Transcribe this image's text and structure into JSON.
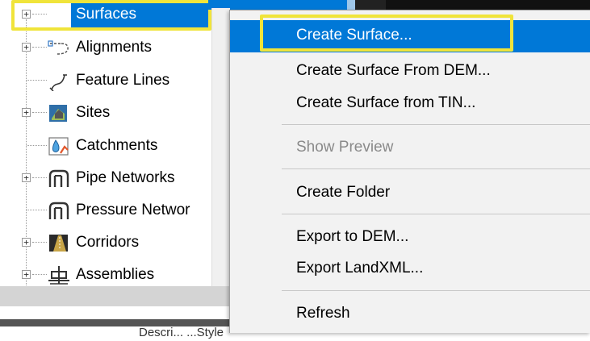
{
  "tree": {
    "items": [
      {
        "label": "Surfaces",
        "icon": "surface-icon",
        "expandable": true,
        "selected": true
      },
      {
        "label": "Alignments",
        "icon": "alignment-icon",
        "expandable": true,
        "selected": false
      },
      {
        "label": "Feature Lines",
        "icon": "feature-line-icon",
        "expandable": false,
        "selected": false
      },
      {
        "label": "Sites",
        "icon": "site-icon",
        "expandable": true,
        "selected": false
      },
      {
        "label": "Catchments",
        "icon": "catchment-icon",
        "expandable": false,
        "selected": false
      },
      {
        "label": "Pipe Networks",
        "icon": "pipe-network-icon",
        "expandable": true,
        "selected": false
      },
      {
        "label": "Pressure Networ",
        "icon": "pressure-network-icon",
        "expandable": false,
        "selected": false
      },
      {
        "label": "Corridors",
        "icon": "corridor-icon",
        "expandable": true,
        "selected": false
      },
      {
        "label": "Assemblies",
        "icon": "assembly-icon",
        "expandable": true,
        "selected": false
      }
    ],
    "expander_symbol": "+"
  },
  "context_menu": {
    "items": [
      {
        "label": "Create Surface...",
        "state": "active"
      },
      {
        "label": "Create Surface From DEM...",
        "state": "normal"
      },
      {
        "label": "Create Surface from TIN...",
        "state": "normal"
      },
      {
        "label": "Show Preview",
        "state": "disabled"
      },
      {
        "label": "Create Folder",
        "state": "normal"
      },
      {
        "label": "Export to DEM...",
        "state": "normal"
      },
      {
        "label": "Export LandXML...",
        "state": "normal"
      },
      {
        "label": "Refresh",
        "state": "normal"
      }
    ]
  },
  "status_fragment": "Descri...    ...Style",
  "colors": {
    "selection": "#0078d7",
    "highlight_box": "#f0e43a",
    "menu_background": "#f2f2f2",
    "disabled_text": "#8a8a8a"
  }
}
